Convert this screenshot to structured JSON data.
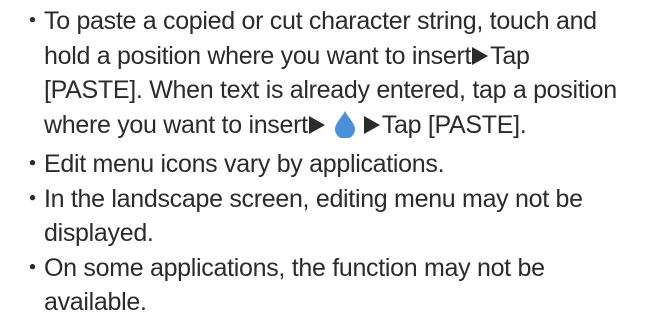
{
  "bullet_char": "・",
  "colors": {
    "text": "#2b2b2b",
    "drop_handle": "#4a90d9"
  },
  "icons": {
    "arrow": "right-triangle-icon",
    "handle": "blue-drop-handle-icon"
  },
  "notes": [
    {
      "line1": "To paste a copied or cut character string, touch and",
      "line2a": "hold a position where you want to insert",
      "line2b": "Tap",
      "line3": "[PASTE]. When text is already entered, tap a position",
      "line4a": "where you want to insert",
      "line4b": "Tap [PASTE]."
    },
    {
      "text": "Edit menu icons vary by applications."
    },
    {
      "line1": "In the landscape screen, editing menu may not be",
      "line2": "displayed."
    },
    {
      "line1": "On some applications, the function may not be",
      "line2": "available."
    }
  ]
}
